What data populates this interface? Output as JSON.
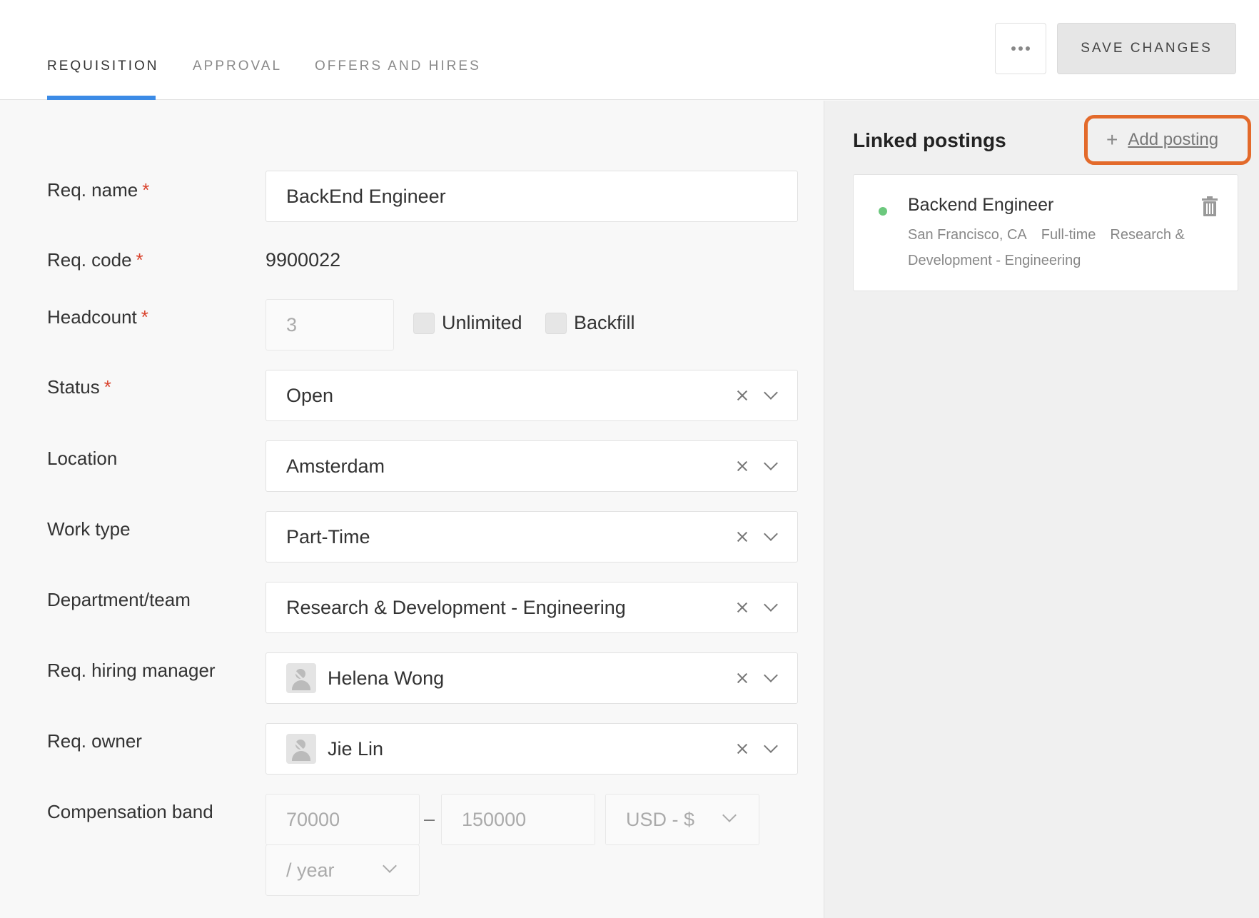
{
  "tabs": [
    {
      "label": "REQUISITION",
      "active": true
    },
    {
      "label": "APPROVAL",
      "active": false
    },
    {
      "label": "OFFERS AND HIRES",
      "active": false
    }
  ],
  "header": {
    "save_label": "SAVE CHANGES",
    "more_icon": "ellipsis-icon"
  },
  "form": {
    "req_name": {
      "label": "Req. name",
      "value": "BackEnd Engineer",
      "required": "*"
    },
    "req_code": {
      "label": "Req. code",
      "value": "9900022",
      "required": "*"
    },
    "headcount": {
      "label": "Headcount",
      "value": "3",
      "required": "*",
      "unlimited_label": "Unlimited",
      "backfill_label": "Backfill"
    },
    "status": {
      "label": "Status",
      "value": "Open",
      "required": "*"
    },
    "location": {
      "label": "Location",
      "value": "Amsterdam"
    },
    "work_type": {
      "label": "Work type",
      "value": "Part-Time"
    },
    "department": {
      "label": "Department/team",
      "value": "Research & Development - Engineering"
    },
    "hiring_manager": {
      "label": "Req. hiring manager",
      "value": "Helena Wong"
    },
    "owner": {
      "label": "Req. owner",
      "value": "Jie Lin"
    },
    "compensation": {
      "label": "Compensation band",
      "min": "70000",
      "dash": "–",
      "max": "150000",
      "currency": "USD - $",
      "period": "/ year"
    }
  },
  "panel": {
    "title": "Linked postings",
    "add_label": "Add posting",
    "posting": {
      "title": "Backend Engineer",
      "location": "San Francisco, CA",
      "commitment": "Full-time",
      "team": "Research & Development - Engineering",
      "status_color": "#6cc87d"
    }
  },
  "colors": {
    "accent": "#3c8be6",
    "highlight": "#e36a2b",
    "required": "#d9412b"
  }
}
